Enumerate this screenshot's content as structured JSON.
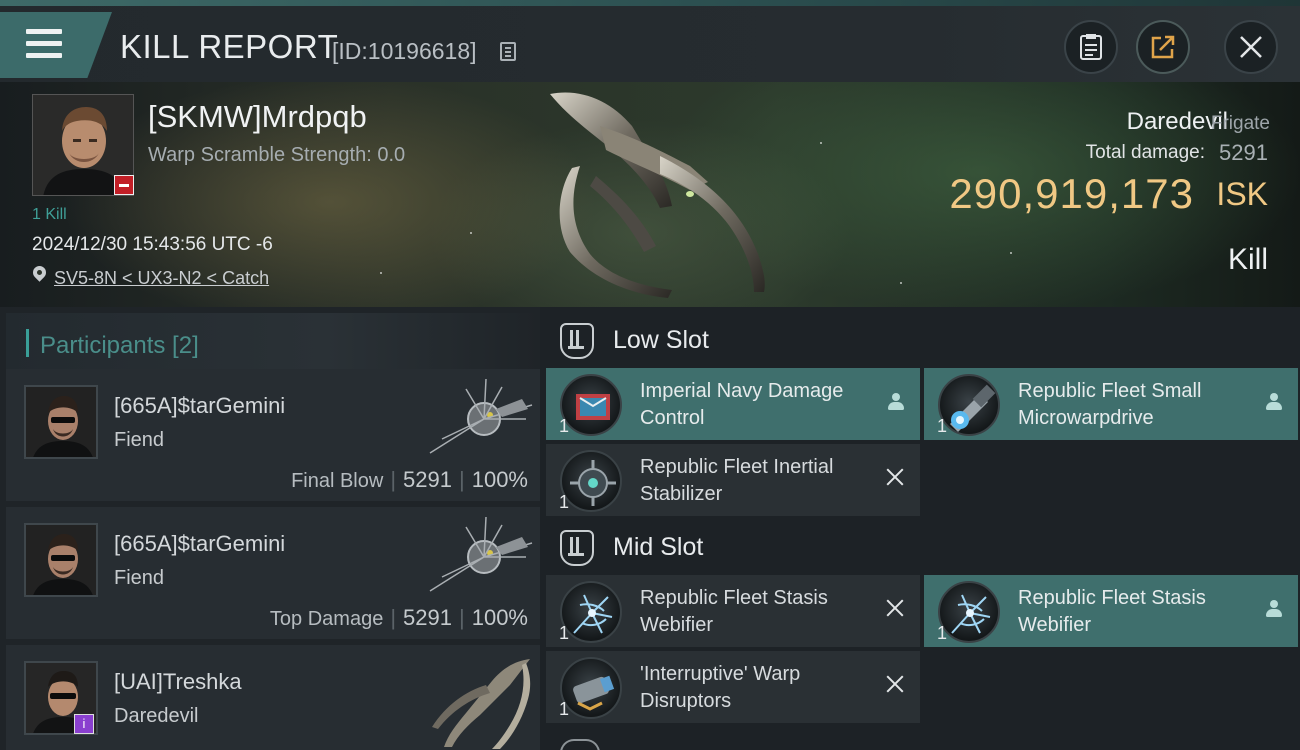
{
  "header": {
    "title": "KILL REPORT",
    "report_id": "[ID:10196618]"
  },
  "victim": {
    "name": "[SKMW]Mrdpqb",
    "warp_scramble": "Warp Scramble Strength: 0.0",
    "kill_count": "1 Kill",
    "datetime": "2024/12/30 15:43:56 UTC -6",
    "location": "SV5-8N < UX3-N2 < Catch",
    "ship": "Daredevil",
    "ship_class": "Frigate",
    "total_damage_label": "Total damage:",
    "total_damage": "5291",
    "isk_value": "290,919,173",
    "isk_unit": "ISK",
    "result": "Kill"
  },
  "participants": {
    "title": "Participants [2]",
    "rows": [
      {
        "name": "[665A]$tarGemini",
        "ship": "Fiend",
        "label": "Final Blow",
        "damage": "5291",
        "percent": "100%"
      },
      {
        "name": "[665A]$tarGemini",
        "ship": "Fiend",
        "label": "Top Damage",
        "damage": "5291",
        "percent": "100%"
      },
      {
        "name": "[UAI]Treshka",
        "ship": "Daredevil"
      }
    ]
  },
  "slots": {
    "low": {
      "title": "Low Slot",
      "modules": [
        {
          "name": "Imperial Navy Damage Control",
          "qty": "1",
          "status": "dropped"
        },
        {
          "name": "Republic Fleet Small Microwarpdrive",
          "qty": "1",
          "status": "dropped"
        },
        {
          "name": "Republic Fleet Inertial Stabilizer",
          "qty": "1",
          "status": "destroyed"
        }
      ]
    },
    "mid": {
      "title": "Mid Slot",
      "modules": [
        {
          "name": "Republic Fleet Stasis Webifier",
          "qty": "1",
          "status": "destroyed"
        },
        {
          "name": "Republic Fleet Stasis Webifier",
          "qty": "1",
          "status": "dropped"
        },
        {
          "name": "'Interruptive' Warp Disruptors",
          "qty": "1",
          "status": "destroyed"
        }
      ]
    }
  },
  "colors": {
    "accent": "#3f6f6d",
    "isk": "#f0c884",
    "victim_badge": "#c21f27",
    "corp_badge": "#8a3fcf"
  },
  "icons": [
    "menu-icon",
    "copy-icon",
    "clipboard-icon",
    "share-icon",
    "close-icon",
    "location-pin-icon",
    "slot-icon",
    "person-icon",
    "x-icon"
  ]
}
